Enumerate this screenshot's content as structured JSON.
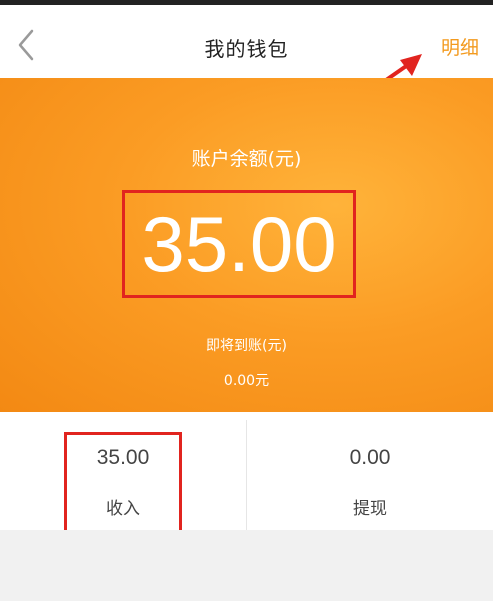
{
  "header": {
    "title": "我的钱包",
    "detail_link": "明细"
  },
  "balance": {
    "label": "账户余额(元)",
    "amount": "35.00",
    "pending_label": "即将到账(元)",
    "pending_amount": "0.00元"
  },
  "stats": {
    "income": {
      "value": "35.00",
      "label": "收入"
    },
    "withdraw": {
      "value": "0.00",
      "label": "提现"
    }
  },
  "colors": {
    "accent": "#f39a1e",
    "panel": "#fb9c24",
    "annotation": "#e1241f"
  },
  "icons": {
    "back": "chevron-left-icon",
    "annotation": "arrow-icon"
  }
}
